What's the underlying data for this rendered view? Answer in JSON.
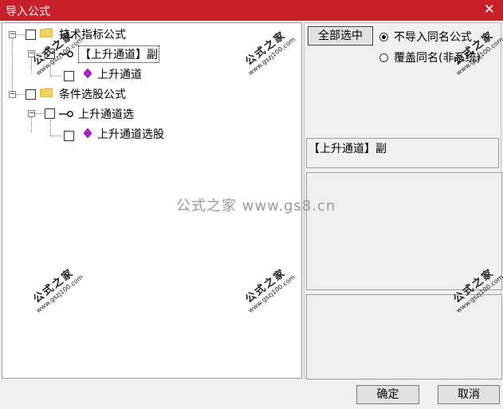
{
  "window": {
    "title": "导入公式",
    "close_glyph": "✕"
  },
  "tree": {
    "nodes": [
      {
        "label": "技术指标公式"
      },
      {
        "label": "【上升通道】副"
      },
      {
        "label": "上升通道"
      },
      {
        "label": "条件选股公式"
      },
      {
        "label": "上升通道选"
      },
      {
        "label": "上升通道选股"
      }
    ],
    "expander_glyph": "−"
  },
  "right": {
    "select_all_label": "全部选中",
    "radio_skip_label": "不导入同名公式",
    "radio_overwrite_label": "覆盖同名(非系统)",
    "selected_name": "【上升通道】副"
  },
  "center_watermark": "公式之家 www.gs8.cn",
  "stamp_watermark": {
    "title": "公式之家",
    "url": "www.gszj100.com"
  },
  "footer": {
    "ok_label": "确定",
    "cancel_label": "取消"
  },
  "colors": {
    "titlebar": "#c8202a",
    "gem": "#b51ad6",
    "folder": "#f2d35a"
  },
  "icons": [
    "folder-icon",
    "gem-icon",
    "key-icon",
    "close-icon"
  ]
}
